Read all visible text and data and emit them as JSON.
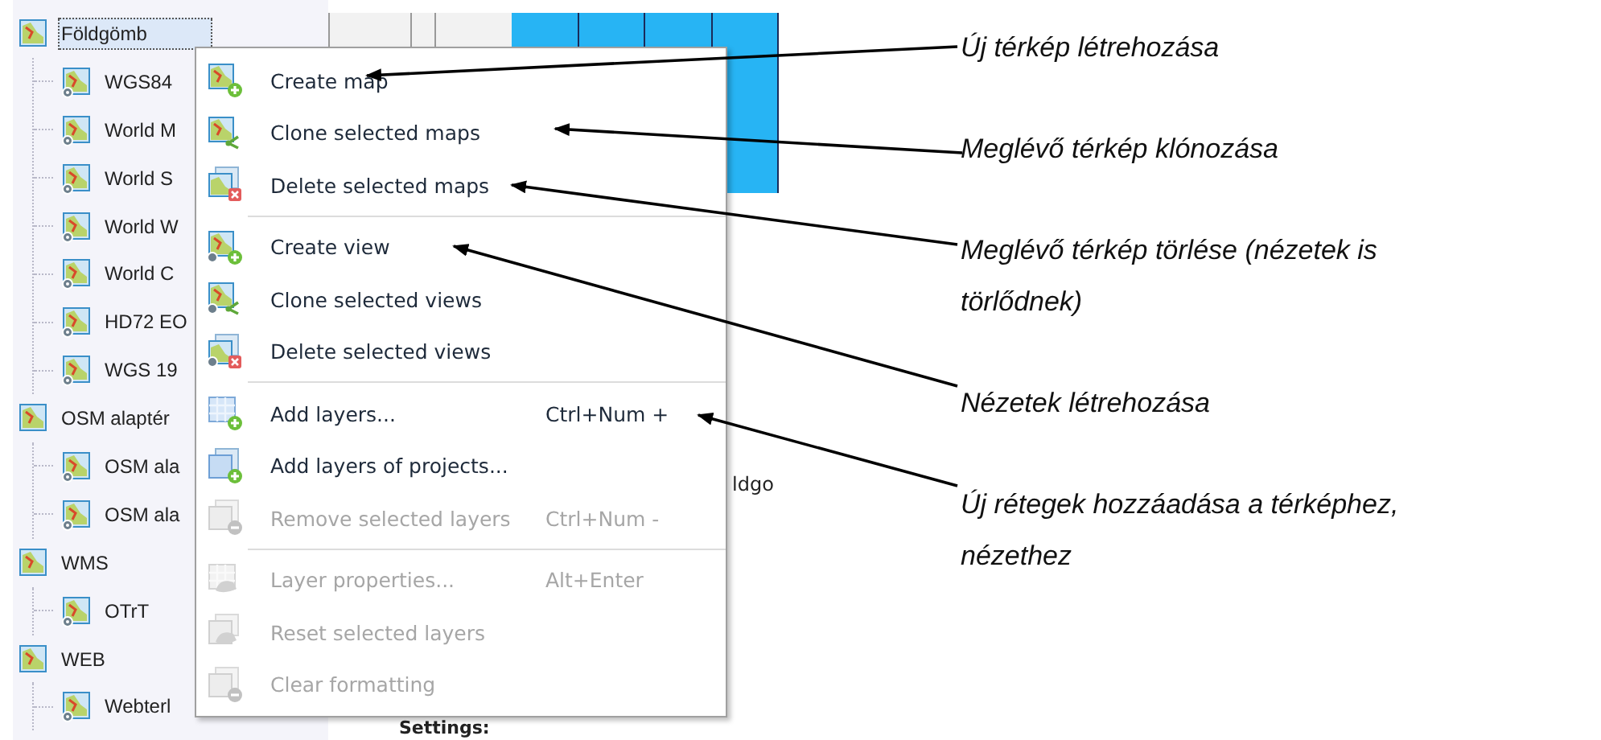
{
  "tree": [
    {
      "label": "Földgömb",
      "selected": true,
      "children": [
        {
          "label": "WGS84",
          "selected": false
        },
        {
          "label": "World M",
          "selected": false
        },
        {
          "label": "World S",
          "selected": false
        },
        {
          "label": "World W",
          "selected": false
        },
        {
          "label": "World C",
          "selected": false
        },
        {
          "label": "HD72 EO",
          "selected": false
        },
        {
          "label": "WGS 19",
          "selected": false
        }
      ]
    },
    {
      "label": "OSM alaptér",
      "selected": false,
      "children": [
        {
          "label": "OSM ala",
          "selected": false
        },
        {
          "label": "OSM ala",
          "selected": false
        }
      ]
    },
    {
      "label": "WMS",
      "selected": false,
      "children": [
        {
          "label": "OTrT",
          "selected": false
        }
      ]
    },
    {
      "label": "WEB",
      "selected": false,
      "children": [
        {
          "label": "Webterl",
          "selected": false
        }
      ]
    }
  ],
  "background_panel": {
    "grid_text": "ldgo",
    "settings_label": "Settings:"
  },
  "context_menu": {
    "groups": [
      [
        {
          "label": "Create map",
          "disabled": false
        },
        {
          "label": "Clone selected maps",
          "disabled": false
        },
        {
          "label": "Delete selected maps",
          "disabled": false
        }
      ],
      [
        {
          "label": "Create view",
          "disabled": false
        },
        {
          "label": "Clone selected views",
          "disabled": false
        },
        {
          "label": "Delete selected views",
          "disabled": false
        }
      ],
      [
        {
          "label": "Add layers...",
          "shortcut": "Ctrl+Num +",
          "disabled": false
        },
        {
          "label": "Add layers of projects...",
          "disabled": false
        },
        {
          "label": "Remove selected layers",
          "shortcut": "Ctrl+Num -",
          "disabled": true
        }
      ],
      [
        {
          "label": "Layer properties...",
          "shortcut": "Alt+Enter",
          "disabled": true
        },
        {
          "label": "Reset selected layers",
          "disabled": true
        },
        {
          "label": "Clear formatting",
          "disabled": true
        }
      ]
    ]
  },
  "callouts": [
    {
      "text": "Új térkép létrehozása"
    },
    {
      "text": "Meglévő térkép klónozása"
    },
    {
      "text": "Meglévő térkép törlése (nézetek is törlődnek)"
    },
    {
      "text": "Nézetek létrehozása"
    },
    {
      "text": "Új rétegek hozzáadása a térképhez, nézethez"
    }
  ]
}
